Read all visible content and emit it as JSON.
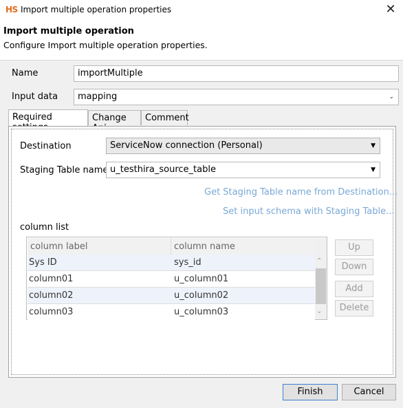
{
  "window": {
    "app_badge": "HS",
    "title": "Import multiple operation properties",
    "close_glyph": "✕"
  },
  "header": {
    "title": "Import multiple operation",
    "description": "Configure Import multiple operation properties."
  },
  "form": {
    "name_label": "Name",
    "name_value": "importMultiple",
    "input_data_label": "Input data",
    "input_data_value": "mapping"
  },
  "tabs": [
    {
      "label": "Required settings"
    },
    {
      "label": "Change Api"
    },
    {
      "label": "Comment"
    }
  ],
  "required": {
    "destination_label": "Destination",
    "destination_value": "ServiceNow connection (Personal)",
    "staging_label": "Staging Table name",
    "staging_value": "u_testhira_source_table",
    "get_staging_link": "Get Staging Table name from Destination...",
    "set_schema_link": "Set input schema with Staging Table...",
    "column_list_label": "column list"
  },
  "table": {
    "headers": [
      "column label",
      "column name"
    ],
    "rows": [
      [
        "Sys ID",
        "sys_id"
      ],
      [
        "column01",
        "u_column01"
      ],
      [
        "column02",
        "u_column02"
      ],
      [
        "column03",
        "u_column03"
      ]
    ]
  },
  "side_buttons": {
    "up": "Up",
    "down": "Down",
    "add": "Add",
    "delete": "Delete"
  },
  "footer": {
    "finish": "Finish",
    "cancel": "Cancel"
  }
}
